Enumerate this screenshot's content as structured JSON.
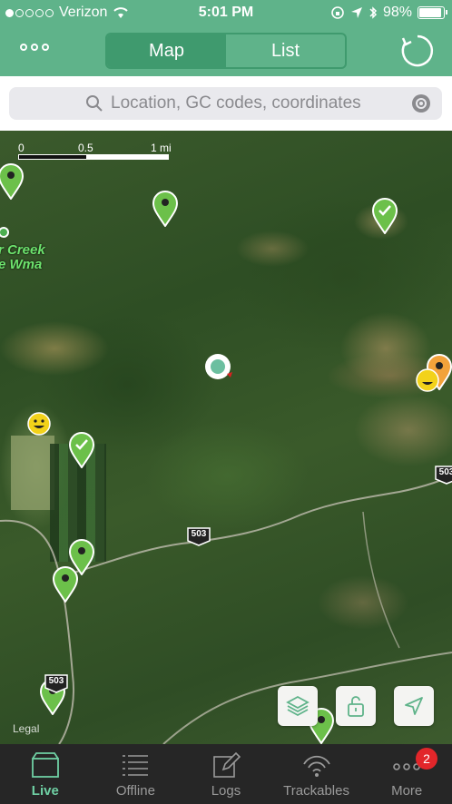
{
  "status_bar": {
    "carrier": "Verizon",
    "time": "5:01 PM",
    "battery": "98%",
    "signal_bars_full": 1,
    "signal_bars_total": 5
  },
  "nav": {
    "segments": [
      {
        "label": "Map",
        "active": true
      },
      {
        "label": "List",
        "active": false
      }
    ]
  },
  "search": {
    "placeholder": "Location, GC codes, coordinates"
  },
  "map": {
    "scale_labels": [
      "0",
      "0.5",
      "1 mi"
    ],
    "place_label_line1": "r Creek",
    "place_label_line2": "e Wma",
    "highway_number": "503",
    "legal": "Legal"
  },
  "colors": {
    "accent": "#5fb38a",
    "accent_dark": "#3f9a6e",
    "pin_green": "#6cc04a",
    "pin_orange": "#f2a23a",
    "tab_active": "#6fd0a4",
    "badge": "#e2262a"
  },
  "tabs": [
    {
      "label": "Live",
      "icon": "box-icon",
      "active": true
    },
    {
      "label": "Offline",
      "icon": "list-icon",
      "active": false
    },
    {
      "label": "Logs",
      "icon": "pencil-icon",
      "active": false
    },
    {
      "label": "Trackables",
      "icon": "signal-icon",
      "active": false
    },
    {
      "label": "More",
      "icon": "ellipsis-icon",
      "active": false,
      "badge": "2"
    }
  ]
}
